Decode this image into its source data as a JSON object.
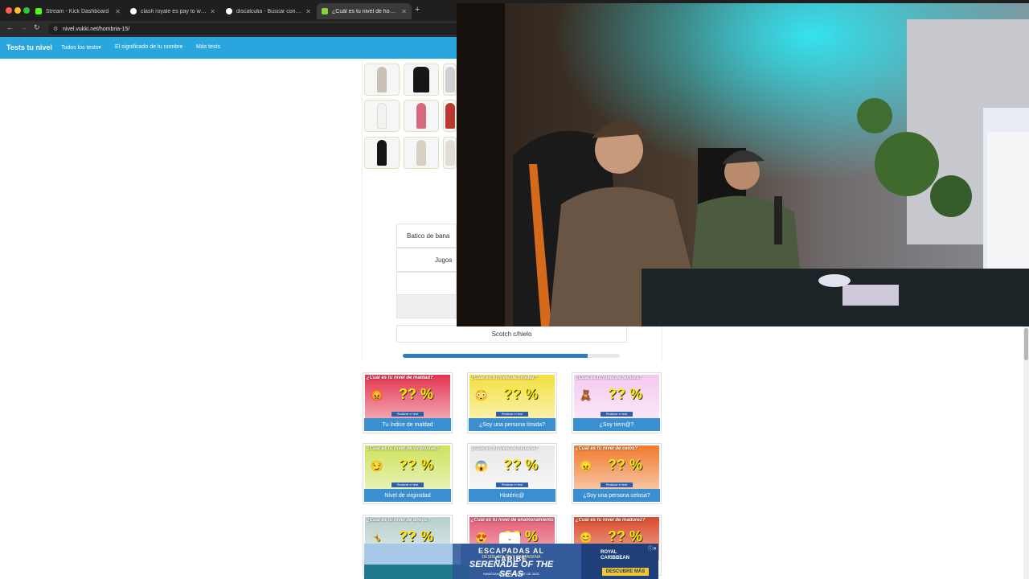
{
  "browser": {
    "tabs": [
      {
        "title": "Stream - Kick Dashboard",
        "favicon_color": "#53fc18"
      },
      {
        "title": "clash royale es pay to win o p",
        "favicon_color": "#ffffff"
      },
      {
        "title": "discalculia - Buscar con Goo",
        "favicon_color": "#ffffff"
      },
      {
        "title": "¿Cuál es tu nivel de hombría?",
        "favicon_color": "#8bd13a"
      }
    ],
    "url": "nivel.vukki.net/hombria-15/"
  },
  "site": {
    "brand": "Tests tu nivel",
    "nav": [
      "Todos los tests▾",
      "El significado de tu nombre",
      "Más tests"
    ]
  },
  "quiz": {
    "answers": [
      "Batico de bana",
      "Jugos",
      "",
      "Scotch c/hielo"
    ],
    "progress_fraction": 0.85
  },
  "cards": [
    {
      "title": "¿Cuál es tu nivel de maldad?",
      "caption": "Tu índice de maldad",
      "emoji": "😡",
      "bg": "#e2344f",
      "button": "Realizar el test"
    },
    {
      "title": "¿Cuál es tu nivel de timidez?",
      "caption": "¿Soy una persona tímida?",
      "emoji": "😳",
      "bg": "#f3df3e",
      "button": "Realizar el test"
    },
    {
      "title": "¿Cuál es tu nivel de ternura?",
      "caption": "¿Soy tiern@?",
      "emoji": "🧸",
      "bg": "#f4c9f0",
      "button": "Realizar el test"
    },
    {
      "title": "¿Cuál es tu nivel de virginidad?",
      "caption": "Nivel de virginidad",
      "emoji": "😏",
      "bg": "#cde25c",
      "button": "Realizar el test"
    },
    {
      "title": "¿Cuál es tu nivel de histeria?",
      "caption": "Histéric@",
      "emoji": "😱",
      "bg": "#e9e9e9",
      "button": "Realizar el test"
    },
    {
      "title": "¿Cuál es tu nivel de celos?",
      "caption": "¿Soy una persona celosa?",
      "emoji": "😠",
      "bg": "#f07a2e",
      "button": "Realizar el test"
    },
    {
      "title": "¿Cuál es tu nivel de amigo?",
      "caption": "",
      "emoji": "🤸",
      "bg": "#b7d0cf",
      "button": ""
    },
    {
      "title": "¿Cuál es tu nivel de enamoramiento?",
      "caption": "",
      "emoji": "😍",
      "bg": "#e35a74",
      "button": ""
    },
    {
      "title": "¿Cuál es tu nivel de madurez?",
      "caption": "",
      "emoji": "😊",
      "bg": "#d94a2c",
      "button": ""
    }
  ],
  "card_percent": "?? %",
  "ad": {
    "line1": "ESCAPADAS AL CARIBE",
    "line2": "DESDE COLÓN Y CARTAGENA",
    "line3": "SERENADE OF THE SEAS",
    "line4": "NAVEGANDO EN OCTUBRE DE 2025",
    "brand": "ROYAL\nCARIBBEAN",
    "cta": "DESCUBRE MÁS"
  }
}
